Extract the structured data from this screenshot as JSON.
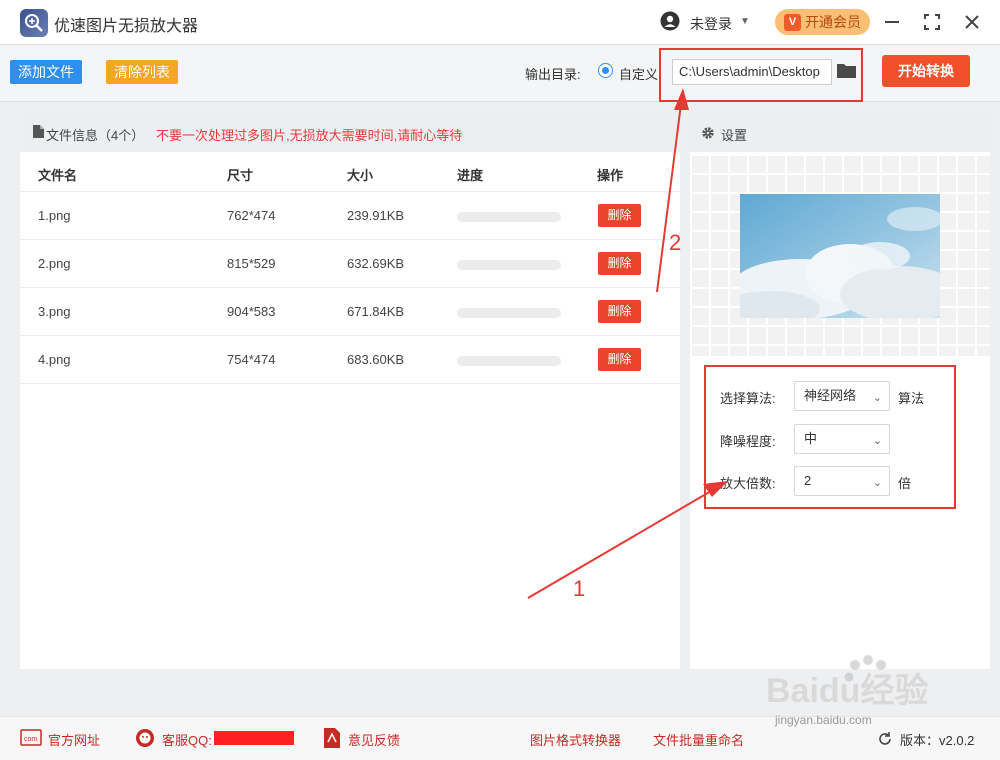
{
  "app": {
    "title": "优速图片无损放大器",
    "user_label": "未登录",
    "vip_label": "开通会员",
    "vip_badge": "V"
  },
  "toolbar": {
    "add_label": "添加文件",
    "clear_label": "清除列表",
    "output_label": "输出目录:",
    "radio_label": "自定义",
    "path_value": "C:\\Users\\admin\\Desktop",
    "start_label": "开始转换"
  },
  "files": {
    "title": "文件信息（4个）",
    "warning": "不要一次处理过多图片,无损放大需要时间,请耐心等待",
    "columns": [
      "文件名",
      "尺寸",
      "大小",
      "进度",
      "操作"
    ],
    "rows": [
      {
        "name": "1.png",
        "size": "762*474",
        "filesize": "239.91KB",
        "progress": 0,
        "action": "删除"
      },
      {
        "name": "2.png",
        "size": "815*529",
        "filesize": "632.69KB",
        "progress": 0,
        "action": "删除"
      },
      {
        "name": "3.png",
        "size": "904*583",
        "filesize": "671.84KB",
        "progress": 0,
        "action": "删除"
      },
      {
        "name": "4.png",
        "size": "754*474",
        "filesize": "683.60KB",
        "progress": 0,
        "action": "删除"
      }
    ]
  },
  "settings": {
    "title": "设置",
    "algo_label": "选择算法:",
    "algo_value": "神经网络",
    "algo_suffix": "算法",
    "noise_label": "降噪程度:",
    "noise_value": "中",
    "scale_label": "放大倍数:",
    "scale_value": "2",
    "scale_suffix": "倍"
  },
  "footer": {
    "website": "官方网址",
    "qq": "客服QQ:",
    "feedback": "意见反馈",
    "converter": "图片格式转换器",
    "rename": "文件批量重命名",
    "version": "版本：v2.0.2"
  },
  "annotations": {
    "one": "1",
    "two": "2"
  },
  "watermark": {
    "brand": "Baidu经验",
    "url": "jingyan.baidu.com"
  },
  "colors": {
    "accent_blue": "#2f8ff0",
    "accent_orange": "#f5a623",
    "start_red": "#f1502a",
    "warning_red": "#e63a3a",
    "annotation_red": "#e53935"
  }
}
